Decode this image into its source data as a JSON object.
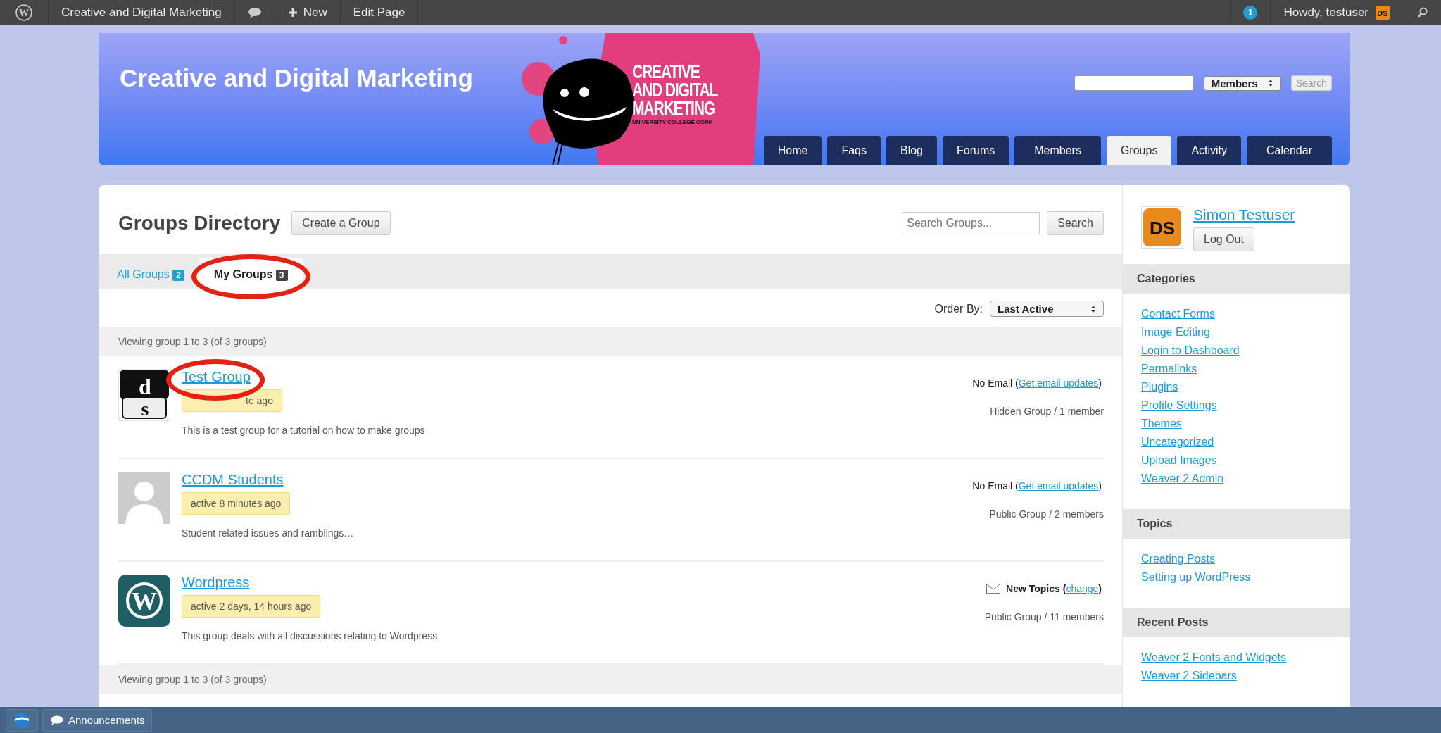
{
  "admin_bar": {
    "logo_letter": "W",
    "avatar_text": "DS",
    "site_title": "Creative and Digital Marketing",
    "new_label": "New",
    "edit_label": "Edit Page",
    "notification_count": "1",
    "greeting": "Howdy, testuser"
  },
  "header": {
    "site_title": "Creative and Digital Marketing",
    "logo_lines": [
      "CREATIVE",
      "AND DIGITAL",
      "MARKETING"
    ],
    "logo_subline": "UNIVERSITY COLLEGE CORK",
    "scope_select": "Members",
    "search_button": "Search"
  },
  "nav_tabs": [
    {
      "label": "Home",
      "selected": false
    },
    {
      "label": "Faqs",
      "selected": false
    },
    {
      "label": "Blog",
      "selected": false
    },
    {
      "label": "Forums",
      "selected": false
    },
    {
      "label": "Members",
      "selected": false
    },
    {
      "label": "Groups",
      "selected": true
    },
    {
      "label": "Activity",
      "selected": false
    },
    {
      "label": "Calendar",
      "selected": false
    }
  ],
  "directory": {
    "title": "Groups Directory",
    "create_button": "Create a Group",
    "search_placeholder": "Search Groups...",
    "search_button": "Search",
    "filter_tabs": [
      {
        "label": "All Groups",
        "count": "2",
        "selected": false,
        "circled": false
      },
      {
        "label": "My Groups",
        "count": "3",
        "selected": true,
        "circled": true
      }
    ],
    "order_label": "Order By:",
    "order_value": "Last Active",
    "pagination_top": "Viewing group 1 to 3 (of 3 groups)",
    "groups": [
      {
        "avatar": {
          "kind": "ds",
          "letters": [
            "d",
            "s"
          ]
        },
        "name": "Test Group",
        "name_circled": true,
        "activity": "te ago",
        "description": "This is a test group for a tutorial on how to make groups",
        "email": {
          "kind": "none",
          "before": "No Email (",
          "link": "Get email updates",
          "after": ")"
        },
        "type_members": "Hidden Group / 1 member"
      },
      {
        "avatar": {
          "kind": "silhouette"
        },
        "name": "CCDM Students",
        "name_circled": false,
        "activity": "active 8 minutes ago",
        "description": "Student related issues and ramblings…",
        "email": {
          "kind": "none",
          "before": "No Email (",
          "link": "Get email updates",
          "after": ")"
        },
        "type_members": "Public Group / 2 members"
      },
      {
        "avatar": {
          "kind": "wordpress",
          "letters": [
            "W"
          ]
        },
        "name": "Wordpress",
        "name_circled": false,
        "activity": "active 2 days, 14 hours ago",
        "description": "This group deals with all discussions relating to Wordpress",
        "email": {
          "kind": "topics",
          "before": "New Topics (",
          "link": "change",
          "after": ")"
        },
        "type_members": "Public Group / 11 members"
      }
    ],
    "pagination_bottom": "Viewing group 1 to 3 (of 3 groups)"
  },
  "sidebar": {
    "avatar_text": "DS",
    "user_name": "Simon Testuser",
    "logout_button": "Log Out",
    "widgets": [
      {
        "title": "Categories",
        "links": [
          "Contact Forms",
          "Image Editing",
          "Login to Dashboard",
          "Permalinks",
          "Plugins",
          "Profile Settings",
          "Themes",
          "Uncategorized",
          "Upload Images",
          "Weaver 2 Admin"
        ]
      },
      {
        "title": "Topics",
        "links": [
          "Creating Posts",
          "Setting up WordPress"
        ]
      },
      {
        "title": "Recent Posts",
        "links": [
          "Weaver 2 Fonts and Widgets",
          "Weaver 2 Sidebars"
        ]
      }
    ]
  },
  "bottom_bar": {
    "items": [
      "Announcements"
    ]
  }
}
